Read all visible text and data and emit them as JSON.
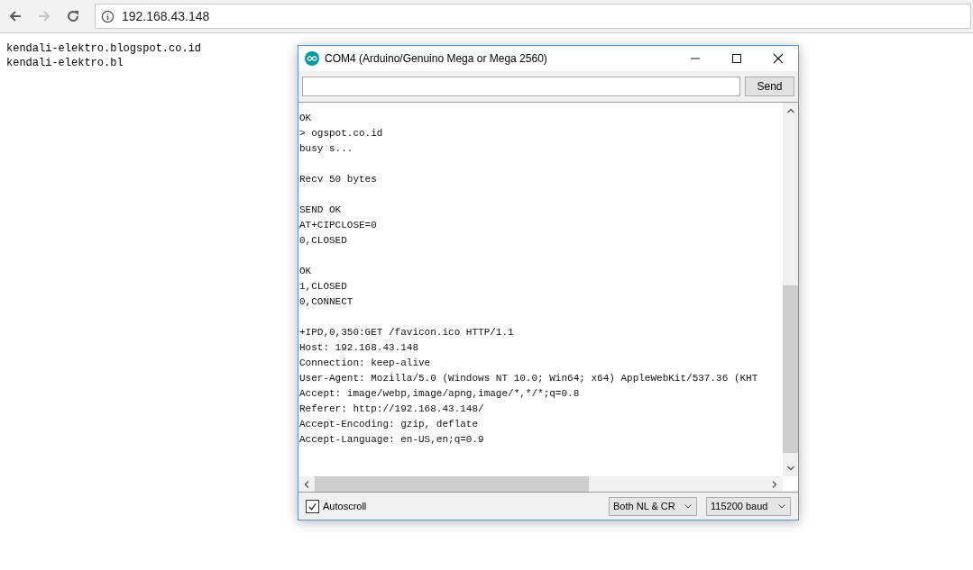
{
  "browser": {
    "address": "192.168.43.148"
  },
  "page": {
    "lines": [
      "kendali-elektro.blogspot.co.id",
      "kendali-elektro.bl"
    ]
  },
  "serial_monitor": {
    "title": "COM4 (Arduino/Genuino Mega or Mega 2560)",
    "send_button": "Send",
    "output_blocks": [
      [
        "OK",
        "> ogspot.co.id",
        "busy s..."
      ],
      [
        "Recv 50 bytes"
      ],
      [
        "SEND OK",
        "AT+CIPCLOSE=0",
        "0,CLOSED"
      ],
      [
        "OK",
        "1,CLOSED",
        "0,CONNECT"
      ],
      [
        "+IPD,0,350:GET /favicon.ico HTTP/1.1",
        "Host: 192.168.43.148",
        "Connection: keep-alive",
        "User-Agent: Mozilla/5.0 (Windows NT 10.0; Win64; x64) AppleWebKit/537.36 (KHT",
        "Accept: image/webp,image/apng,image/*,*/*;q=0.8",
        "Referer: http://192.168.43.148/",
        "Accept-Encoding: gzip, deflate",
        "Accept-Language: en-US,en;q=0.9"
      ]
    ],
    "autoscroll": {
      "label": "Autoscroll",
      "checked": true
    },
    "line_ending": "Both NL & CR",
    "baud_rate": "115200 baud"
  }
}
